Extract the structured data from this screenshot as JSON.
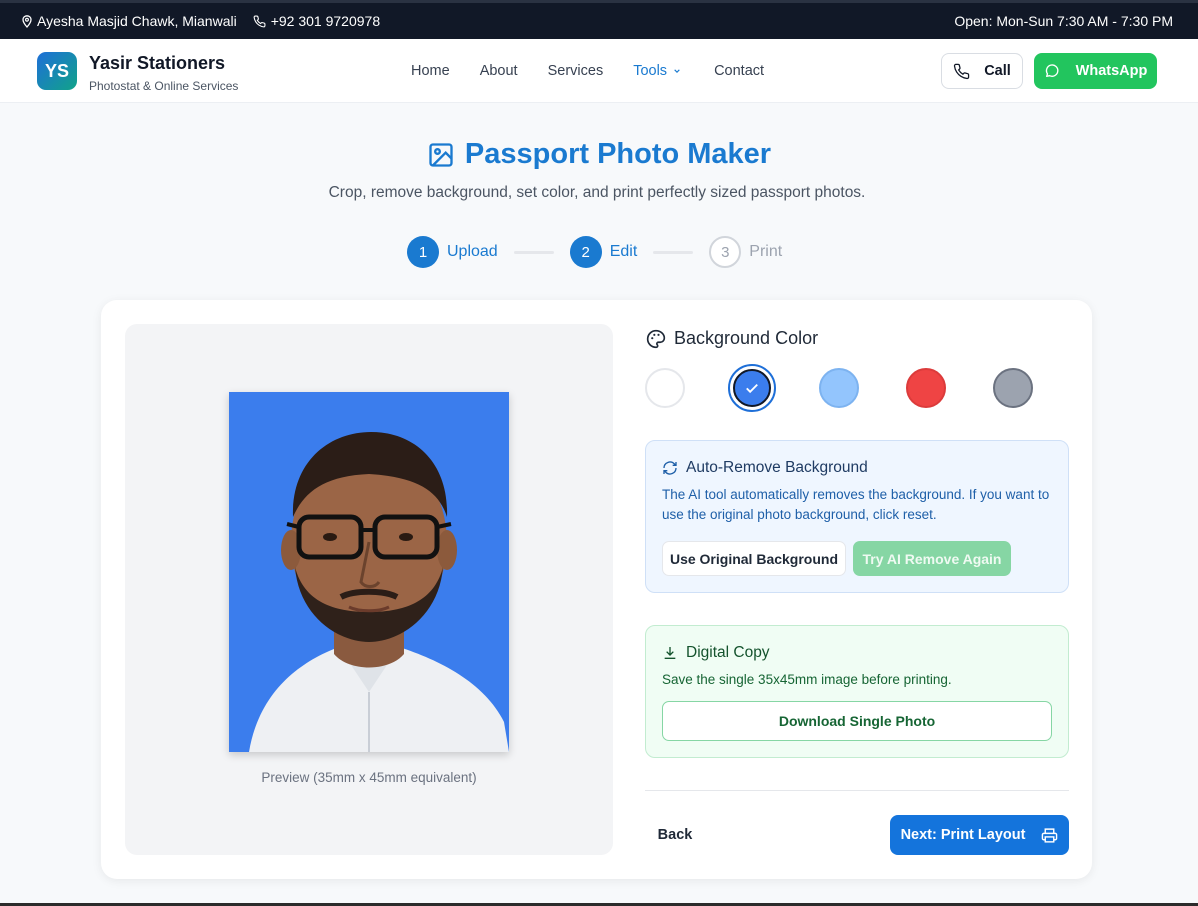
{
  "topbar": {
    "address": "Ayesha Masjid Chawk, Mianwali",
    "phone": "+92 301 9720978",
    "hours": "Open: Mon-Sun 7:30 AM - 7:30 PM"
  },
  "header": {
    "logo_initials": "YS",
    "brand_name": "Yasir Stationers",
    "brand_tagline": "Photostat & Online Services",
    "nav": [
      "Home",
      "About",
      "Services",
      "Tools",
      "Contact"
    ],
    "active_nav": "Tools",
    "call_label": "Call",
    "whatsapp_label": "WhatsApp"
  },
  "page": {
    "title": "Passport Photo Maker",
    "subtitle": "Crop, remove background, set color, and print perfectly sized passport photos."
  },
  "stepper": [
    {
      "number": "1",
      "label": "Upload",
      "state": "done"
    },
    {
      "number": "2",
      "label": "Edit",
      "state": "done"
    },
    {
      "number": "3",
      "label": "Print",
      "state": "todo"
    }
  ],
  "preview": {
    "caption": "Preview (35mm x 45mm equivalent)",
    "background_color": "#3b7ded"
  },
  "background_color": {
    "title": "Background Color",
    "options": [
      "#ffffff",
      "#3b7ded",
      "#93c5fd",
      "#ef4444",
      "#9ca3af"
    ],
    "selected": "#3b7ded"
  },
  "auto_remove": {
    "title": "Auto-Remove Background",
    "description": "The AI tool automatically removes the background. If you want to use the original photo background, click reset.",
    "use_original_label": "Use Original Background",
    "try_again_label": "Try AI Remove Again"
  },
  "digital_copy": {
    "title": "Digital Copy",
    "description": "Save the single 35x45mm image before printing.",
    "download_label": "Download Single Photo"
  },
  "footer_actions": {
    "back_label": "Back",
    "next_label": "Next: Print Layout"
  },
  "colors": {
    "accent": "#1a7ad0",
    "whatsapp": "#22c55e",
    "topbar": "#111827"
  }
}
